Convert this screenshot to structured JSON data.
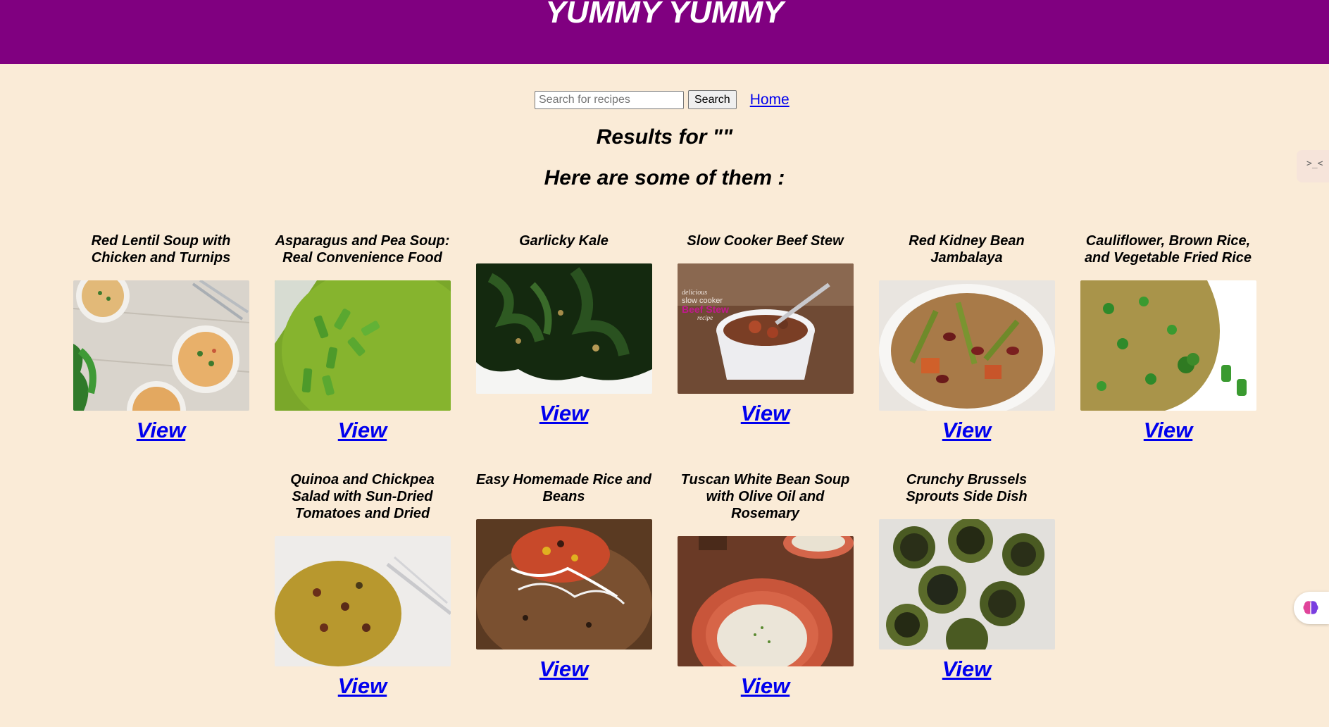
{
  "header": {
    "title": "YUMMY YUMMY",
    "bg_color": "#800080"
  },
  "search": {
    "placeholder": "Search for recipes",
    "value": "",
    "button_label": "Search",
    "home_label": "Home"
  },
  "results": {
    "heading": "Results for \"\"",
    "subheading": "Here are some of them :"
  },
  "recipes": [
    {
      "title": "Red Lentil Soup with Chicken and Turnips",
      "link_label": "View"
    },
    {
      "title": "Asparagus and Pea Soup: Real Convenience Food",
      "link_label": "View"
    },
    {
      "title": "Garlicky Kale",
      "link_label": "View"
    },
    {
      "title": "Slow Cooker Beef Stew",
      "link_label": "View"
    },
    {
      "title": "Red Kidney Bean Jambalaya",
      "link_label": "View"
    },
    {
      "title": "Cauliflower, Brown Rice, and Vegetable Fried Rice",
      "link_label": "View"
    },
    {
      "title": "Quinoa and Chickpea Salad with Sun-Dried Tomatoes and Dried",
      "link_label": "View"
    },
    {
      "title": "Easy Homemade Rice and Beans",
      "link_label": "View"
    },
    {
      "title": "Tuscan White Bean Soup with Olive Oil and Rosemary",
      "link_label": "View"
    },
    {
      "title": "Crunchy Brussels Sprouts Side Dish",
      "link_label": "View"
    }
  ],
  "beef_stew_photo_caption": [
    "delicious",
    "slow cooker",
    "Beef Stew",
    "recipe"
  ],
  "icons": {
    "extension": "puzzle-extension-icon",
    "assistant": "brain-icon"
  },
  "colors": {
    "background": "#faebd7",
    "link": "#0000ee"
  }
}
